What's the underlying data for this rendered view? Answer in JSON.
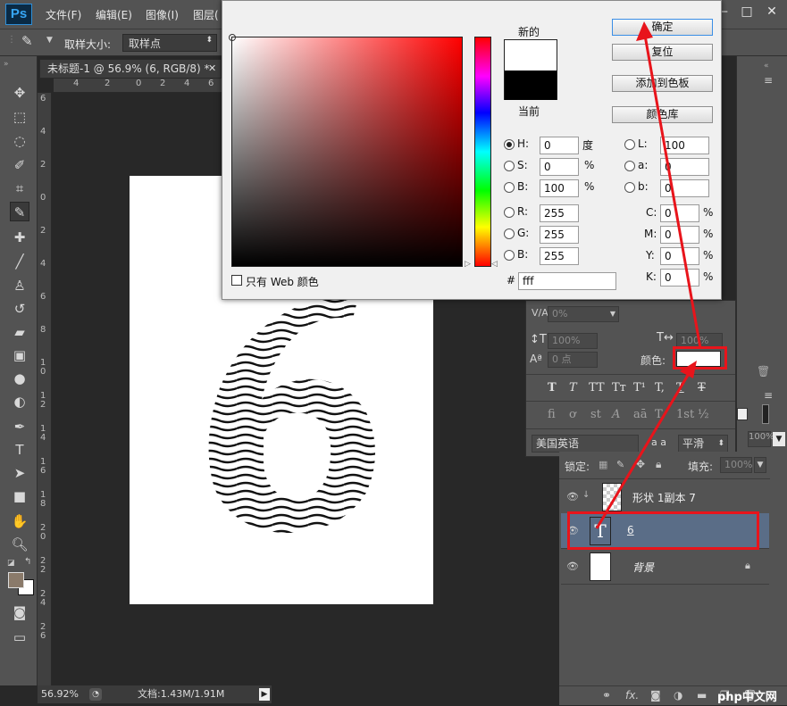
{
  "app": {
    "logo": "Ps"
  },
  "menu": [
    "文件(F)",
    "编辑(E)",
    "图像(I)",
    "图层("
  ],
  "window_buttons": [
    "—",
    "□",
    "✕"
  ],
  "options": {
    "sample_size_label": "取样大小:",
    "sample_size_value": "取样点"
  },
  "document": {
    "tab_title": "未标题-1 @ 56.9% (6, RGB/8) *",
    "glyph": "6"
  },
  "ruler": {
    "h": [
      "4",
      "2",
      "0",
      "2",
      "4",
      "6"
    ],
    "v": [
      "6",
      "4",
      "2",
      "0",
      "2",
      "4",
      "6",
      "8",
      "1\n0",
      "1\n2",
      "1\n4",
      "1\n6",
      "1\n8",
      "2\n0",
      "2\n2",
      "2\n4",
      "2\n6"
    ]
  },
  "status": {
    "zoom": "56.92%",
    "doc_info": "文档:1.43M/1.91M"
  },
  "color_picker": {
    "new_label": "新的",
    "current_label": "当前",
    "new_color": "#ffffff",
    "current_color": "#000000",
    "buttons": {
      "ok": "确定",
      "reset": "复位",
      "add_swatch": "添加到色板",
      "color_library": "颜色库"
    },
    "hsb": [
      {
        "label": "H:",
        "value": "0",
        "unit": "度"
      },
      {
        "label": "S:",
        "value": "0",
        "unit": "%"
      },
      {
        "label": "B:",
        "value": "100",
        "unit": "%"
      }
    ],
    "rgb": [
      {
        "label": "R:",
        "value": "255"
      },
      {
        "label": "G:",
        "value": "255"
      },
      {
        "label": "B:",
        "value": "255"
      }
    ],
    "lab": [
      {
        "label": "L:",
        "value": "100"
      },
      {
        "label": "a:",
        "value": "0"
      },
      {
        "label": "b:",
        "value": "0"
      }
    ],
    "cmyk": [
      {
        "label": "C:",
        "value": "0",
        "unit": "%"
      },
      {
        "label": "M:",
        "value": "0",
        "unit": "%"
      },
      {
        "label": "Y:",
        "value": "0",
        "unit": "%"
      },
      {
        "label": "K:",
        "value": "0",
        "unit": "%"
      }
    ],
    "web_only": "只有 Web 颜色",
    "hash": "#",
    "hex": "fff"
  },
  "character": {
    "tracking": "0%",
    "vscale": "100%",
    "hscale": "100%",
    "baseline": "0 点",
    "color_label": "颜色:",
    "glyphs": [
      "T",
      "T",
      "TT",
      "Tт",
      "T¹",
      "T,",
      "T",
      "Ŧ"
    ],
    "ot_glyphs": [
      "fi",
      "ơ",
      "st",
      "A",
      "aā",
      "T",
      "1st",
      "½"
    ],
    "language": "美国英语",
    "aa_label": "a a",
    "aa_value": "平滑"
  },
  "layers": {
    "opacity": "100%",
    "lock_label": "锁定:",
    "fill_label": "填充:",
    "fill_value": "100%",
    "items": [
      {
        "name": "形状 1副本 7"
      },
      {
        "name": "6"
      },
      {
        "name": "背景"
      }
    ]
  },
  "watermark": "php中文网"
}
